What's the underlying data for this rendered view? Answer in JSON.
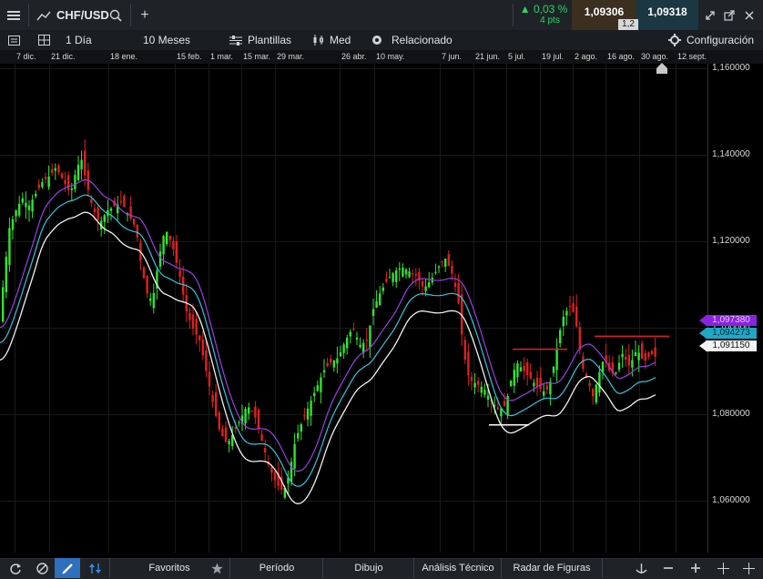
{
  "header": {
    "symbol": "CHF/USD",
    "add_tab": "+",
    "change_pct": "0,03 %",
    "change_pts": "4 pts",
    "bid": "1,09306",
    "ask": "1,09318",
    "spread": "1,2"
  },
  "toolbar": {
    "interval": "1 Día",
    "range": "10 Meses",
    "templates": "Plantillas",
    "chart_style": "Med",
    "related": "Relacionado",
    "settings": "Configuración"
  },
  "bottom": {
    "favorites": "Favoritos",
    "period": "Período",
    "drawing": "Dibujo",
    "technical": "Análisis Técnico",
    "patterns": "Radar de Figuras"
  },
  "colors": {
    "bull": "#2ee62e",
    "bear": "#e02020",
    "ma_purple": "#9a3fe6",
    "ma_cyan": "#2fc6e0",
    "ma_white": "#f2f2f2",
    "level_red": "#e02020"
  },
  "chart_data": {
    "type": "candlestick",
    "symbol": "CHF/USD",
    "x_labels": [
      "7 dic.",
      "21 dic.",
      "18 ene.",
      "15 feb.",
      "1 mar.",
      "15 mar.",
      "29 mar.",
      "26 abr.",
      "10 may.",
      "7 jun.",
      "21 jun.",
      "5 jul.",
      "19 jul.",
      "2 ago.",
      "16 ago.",
      "30 ago.",
      "12 sept."
    ],
    "y_ticks": [
      "1,160000",
      "1,140000",
      "1,120000",
      "1,100000",
      "1,080000",
      "1,060000"
    ],
    "ylim": [
      1.048,
      1.161
    ],
    "close_path": [
      [
        0,
        1.101
      ],
      [
        5,
        1.112
      ],
      [
        11,
        1.123
      ],
      [
        18,
        1.127
      ],
      [
        25,
        1.13
      ],
      [
        32,
        1.128
      ],
      [
        40,
        1.131
      ],
      [
        48,
        1.134
      ],
      [
        55,
        1.135
      ],
      [
        62,
        1.137
      ],
      [
        70,
        1.134
      ],
      [
        78,
        1.131
      ],
      [
        85,
        1.137
      ],
      [
        90,
        1.139
      ],
      [
        96,
        1.133
      ],
      [
        102,
        1.128
      ],
      [
        110,
        1.124
      ],
      [
        118,
        1.127
      ],
      [
        126,
        1.128
      ],
      [
        134,
        1.129
      ],
      [
        142,
        1.126
      ],
      [
        150,
        1.123
      ],
      [
        156,
        1.114
      ],
      [
        162,
        1.108
      ],
      [
        168,
        1.106
      ],
      [
        175,
        1.116
      ],
      [
        182,
        1.123
      ],
      [
        190,
        1.119
      ],
      [
        198,
        1.112
      ],
      [
        205,
        1.104
      ],
      [
        212,
        1.1
      ],
      [
        220,
        1.097
      ],
      [
        228,
        1.089
      ],
      [
        235,
        1.082
      ],
      [
        242,
        1.076
      ],
      [
        250,
        1.073
      ],
      [
        258,
        1.076
      ],
      [
        265,
        1.079
      ],
      [
        272,
        1.082
      ],
      [
        280,
        1.08
      ],
      [
        288,
        1.074
      ],
      [
        296,
        1.068
      ],
      [
        304,
        1.064
      ],
      [
        312,
        1.062
      ],
      [
        318,
        1.066
      ],
      [
        325,
        1.074
      ],
      [
        332,
        1.078
      ],
      [
        340,
        1.082
      ],
      [
        348,
        1.086
      ],
      [
        356,
        1.09
      ],
      [
        364,
        1.092
      ],
      [
        372,
        1.093
      ],
      [
        380,
        1.097
      ],
      [
        388,
        1.1
      ],
      [
        396,
        1.096
      ],
      [
        404,
        1.097
      ],
      [
        410,
        1.104
      ],
      [
        418,
        1.108
      ],
      [
        426,
        1.111
      ],
      [
        434,
        1.113
      ],
      [
        442,
        1.114
      ],
      [
        450,
        1.113
      ],
      [
        458,
        1.112
      ],
      [
        466,
        1.109
      ],
      [
        474,
        1.111
      ],
      [
        482,
        1.114
      ],
      [
        490,
        1.116
      ],
      [
        498,
        1.112
      ],
      [
        504,
        1.106
      ],
      [
        510,
        1.094
      ],
      [
        516,
        1.088
      ],
      [
        524,
        1.087
      ],
      [
        532,
        1.086
      ],
      [
        540,
        1.083
      ],
      [
        548,
        1.081
      ],
      [
        556,
        1.082
      ],
      [
        562,
        1.088
      ],
      [
        568,
        1.092
      ],
      [
        576,
        1.09
      ],
      [
        584,
        1.088
      ],
      [
        592,
        1.086
      ],
      [
        600,
        1.085
      ],
      [
        606,
        1.088
      ],
      [
        612,
        1.095
      ],
      [
        618,
        1.102
      ],
      [
        626,
        1.105
      ],
      [
        632,
        1.103
      ],
      [
        640,
        1.091
      ],
      [
        646,
        1.088
      ],
      [
        652,
        1.084
      ],
      [
        658,
        1.089
      ],
      [
        664,
        1.093
      ],
      [
        670,
        1.09
      ],
      [
        676,
        1.089
      ],
      [
        684,
        1.094
      ],
      [
        692,
        1.091
      ],
      [
        700,
        1.095
      ],
      [
        708,
        1.092
      ],
      [
        716,
        1.094
      ],
      [
        722,
        1.093
      ]
    ],
    "moving_averages": [
      {
        "color": "purple",
        "last_value": "1,097380"
      },
      {
        "color": "cyan",
        "last_value": "1,094273"
      },
      {
        "color": "white",
        "last_value": "1,091150"
      }
    ],
    "levels": [
      {
        "color": "red",
        "value": 1.095,
        "from": 563,
        "to": 623
      },
      {
        "color": "red",
        "value": 1.098,
        "from": 653,
        "to": 735
      },
      {
        "color": "white",
        "value": 1.0775,
        "from": 537,
        "to": 581
      }
    ]
  }
}
